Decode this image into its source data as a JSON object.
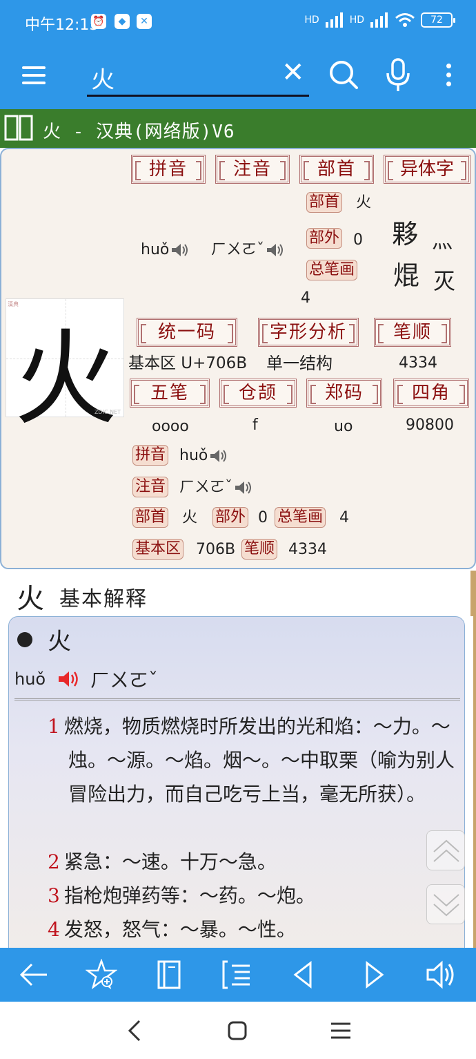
{
  "status_bar": {
    "time": "中午12:15",
    "network": "HD",
    "battery": "72"
  },
  "search": {
    "query": "火"
  },
  "dict_title": "火 - 汉典(网络版)V6",
  "glyph": {
    "char": "火",
    "watermark_top": "漢典",
    "watermark_bottom": "ZDIC.NET"
  },
  "header_buttons": [
    "拼音",
    "注音",
    "部首",
    "异体字"
  ],
  "pinyin_block": {
    "pinyin": "huǒ",
    "zhuyin": "ㄏㄨㄛˇ"
  },
  "bushou_block": {
    "bushou_label": "部首",
    "bushou_value": "火",
    "buwai_label": "部外",
    "buwai_value": "0",
    "zongbihua_label": "总笔画",
    "zongbihua_value": "4"
  },
  "variants": [
    "夥",
    "灬",
    "焜",
    "灭"
  ],
  "code_buttons_row1": [
    "统一码",
    "字形分析",
    "笔顺"
  ],
  "code_values_row1": [
    "基本区 U+706B",
    "单一结构",
    "4334"
  ],
  "code_buttons_row2": [
    "五笔",
    "仓颉",
    "郑码",
    "四角"
  ],
  "code_values_row2": [
    "oooo",
    "f",
    "uo",
    "90800"
  ],
  "summary": {
    "pinyin_label": "拼音",
    "pinyin_value": "huǒ",
    "zhuyin_label": "注音",
    "zhuyin_value": "ㄏㄨㄛˇ",
    "bushou_label": "部首",
    "bushou_value": "火",
    "buwai_label": "部外",
    "buwai_value": "0",
    "zongbihua_label": "总笔画",
    "zongbihua_value": "4",
    "jibenqu_label": "基本区",
    "jibenqu_value": "706B",
    "bishun_label": "笔顺",
    "bishun_value": "4334"
  },
  "explanation": {
    "header_char": "火",
    "header_label": "基本解释",
    "entry_char": "火",
    "entry_pinyin": "huǒ",
    "entry_zhuyin": "ㄏㄨㄛˇ",
    "definitions": [
      {
        "num": "1",
        "text": "燃烧，物质燃烧时所发出的光和焰：～力。～烛。～源。～焰。烟～。～中取栗（喻为别人冒险出力，而自己吃亏上当，毫无所获）。"
      },
      {
        "num": "2",
        "text": "紧急：～速。十万～急。"
      },
      {
        "num": "3",
        "text": "指枪炮弹药等：～药。～炮。"
      },
      {
        "num": "4",
        "text": "发怒，怒气：～暴。～性。"
      }
    ]
  },
  "colors": {
    "primary": "#2e97e8",
    "title_green": "#3a7d2c",
    "label_red": "#8b1010",
    "number_red": "#c0141e"
  }
}
